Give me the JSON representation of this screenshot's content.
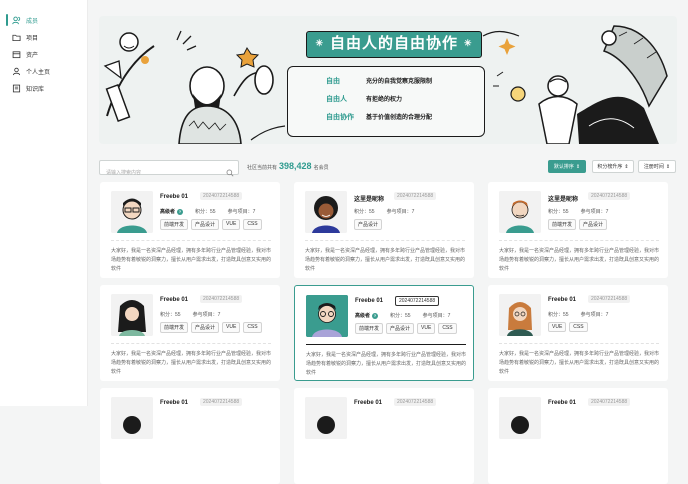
{
  "sidebar": {
    "items": [
      {
        "label": "成员",
        "icon": "people-icon",
        "active": true
      },
      {
        "label": "项目",
        "icon": "folder-icon",
        "active": false
      },
      {
        "label": "资产",
        "icon": "asset-icon",
        "active": false
      },
      {
        "label": "个人主页",
        "icon": "user-icon",
        "active": false
      },
      {
        "label": "知识库",
        "icon": "book-icon",
        "active": false
      }
    ]
  },
  "banner": {
    "title": "自由人的自由协作",
    "definitions": [
      {
        "term": "自由",
        "desc": "充分的自我觉察克服限制"
      },
      {
        "term": "自由人",
        "desc": "有拒绝的权力"
      },
      {
        "term": "自由协作",
        "desc": "基于价值创造的合理分配"
      }
    ]
  },
  "search": {
    "placeholder": "请输入搜索内容"
  },
  "count": {
    "prefix": "社区当前共有",
    "value": "398,428",
    "suffix": "名会员"
  },
  "sorts": [
    {
      "label": "默认排序",
      "primary": true
    },
    {
      "label": "积分榜升序",
      "primary": false
    },
    {
      "label": "注册时间",
      "primary": false
    }
  ],
  "cards": [
    {
      "name": "Freebe 01",
      "id": "2024072214588",
      "role": "高级者",
      "points_label": "积分：",
      "points": "55",
      "projects_label": "参与项目：",
      "projects": "7",
      "tags": [
        "前端开发",
        "产品设计",
        "VUE",
        "CSS"
      ],
      "desc": "大家好，我是一名资深产品经理，拥有多年跨行业产品管理经验，我对市场趋势有着敏锐的洞察力，擅长从用户需求出发，打造既具创意又实用的软件",
      "selected": false
    },
    {
      "name": "这里是昵称",
      "id": "2024072214588",
      "role": "",
      "points_label": "积分：",
      "points": "55",
      "projects_label": "参与项目：",
      "projects": "7",
      "tags": [
        "产品设计"
      ],
      "desc": "大家好，我是一名资深产品经理，拥有多年跨行业产品管理经验，我对市场趋势有着敏锐的洞察力，擅长从用户需求出发，打造既具创意又实用的软件",
      "selected": false
    },
    {
      "name": "这里是昵称",
      "id": "2024072214588",
      "role": "",
      "points_label": "积分：",
      "points": "55",
      "projects_label": "参与项目：",
      "projects": "7",
      "tags": [
        "前端开发",
        "产品设计"
      ],
      "desc": "大家好，我是一名资深产品经理，拥有多年跨行业产品管理经验，我对市场趋势有着敏锐的洞察力，擅长从用户需求出发，打造既具创意又实用的软件",
      "selected": false
    },
    {
      "name": "Freebe 01",
      "id": "2024072214588",
      "role": "",
      "points_label": "积分：",
      "points": "55",
      "projects_label": "参与项目：",
      "projects": "7",
      "tags": [
        "前端开发",
        "产品设计",
        "VUE",
        "CSS"
      ],
      "desc": "大家好，我是一名资深产品经理，拥有多年跨行业产品管理经验，我对市场趋势有着敏锐的洞察力，擅长从用户需求出发，打造既具创意又实用的软件",
      "selected": false
    },
    {
      "name": "Freebe 01",
      "id": "2024072214588",
      "role": "高级者",
      "points_label": "积分：",
      "points": "55",
      "projects_label": "参与项目：",
      "projects": "7",
      "tags": [
        "前端开发",
        "产品设计",
        "VUE",
        "CSS"
      ],
      "desc": "大家好，我是一名资深产品经理，拥有多年跨行业产品管理经验，我对市场趋势有着敏锐的洞察力，擅长从用户需求出发，打造既具创意又实用的软件",
      "selected": true
    },
    {
      "name": "Freebe 01",
      "id": "2024072214588",
      "role": "",
      "points_label": "积分：",
      "points": "55",
      "projects_label": "参与项目：",
      "projects": "7",
      "tags": [
        "VUE",
        "CSS"
      ],
      "desc": "大家好，我是一名资深产品经理，拥有多年跨行业产品管理经验，我对市场趋势有着敏锐的洞察力，擅长从用户需求出发，打造既具创意又实用的软件",
      "selected": false
    },
    {
      "name": "Freebe 01",
      "id": "2024072214588",
      "role": "",
      "points_label": "",
      "points": "",
      "projects_label": "",
      "projects": "",
      "tags": [],
      "desc": "",
      "selected": false
    },
    {
      "name": "Freebe 01",
      "id": "2024072214588",
      "role": "",
      "points_label": "",
      "points": "",
      "projects_label": "",
      "projects": "",
      "tags": [],
      "desc": "",
      "selected": false
    },
    {
      "name": "Freebe 01",
      "id": "2024072214588",
      "role": "",
      "points_label": "",
      "points": "",
      "projects_label": "",
      "projects": "",
      "tags": [],
      "desc": "",
      "selected": false
    }
  ],
  "colors": {
    "accent": "#3a9c8f",
    "ink": "#1b1b1b"
  }
}
